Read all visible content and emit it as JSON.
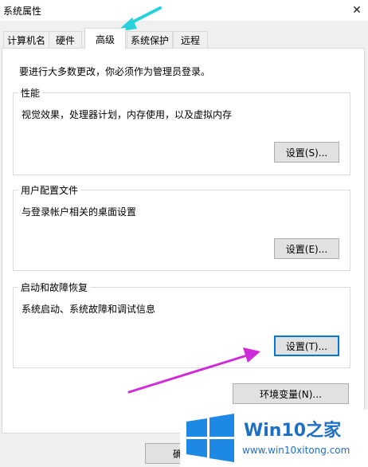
{
  "window": {
    "title": "系统属性",
    "close_icon": "close-icon"
  },
  "tabs": [
    {
      "label": "计算机名",
      "active": false
    },
    {
      "label": "硬件",
      "active": false
    },
    {
      "label": "高级",
      "active": true
    },
    {
      "label": "系统保护",
      "active": false
    },
    {
      "label": "远程",
      "active": false
    }
  ],
  "admin_note": "要进行大多数更改，你必须作为管理员登录。",
  "groups": {
    "performance": {
      "label": "性能",
      "description": "视觉效果，处理器计划，内存使用，以及虚拟内存",
      "button": "设置(S)..."
    },
    "user_profiles": {
      "label": "用户配置文件",
      "description": "与登录帐户相关的桌面设置",
      "button": "设置(E)..."
    },
    "startup_recovery": {
      "label": "启动和故障恢复",
      "description": "系统启动、系统故障和调试信息",
      "button": "设置(T)..."
    }
  },
  "env_button": "环境变量(N)...",
  "bottom_buttons": {
    "ok": "确",
    "cancel": "",
    "apply": ""
  },
  "annotation_arrows": {
    "cyan": "#27d3d9",
    "magenta": "#d12ad8"
  },
  "watermark": {
    "brand": "Win10",
    "brand_suffix": "之家",
    "url": "www.win10xitong.com"
  }
}
